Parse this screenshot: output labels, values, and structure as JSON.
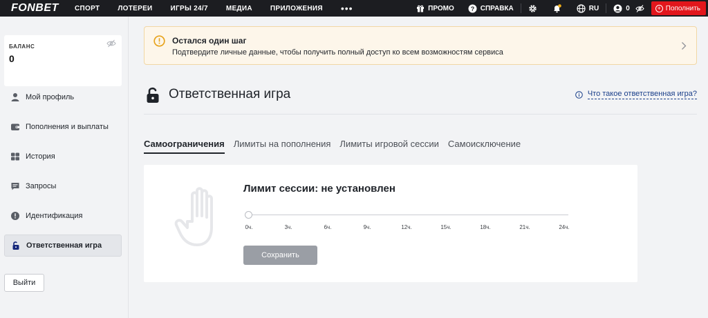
{
  "header": {
    "logo": "FONBET",
    "nav": [
      "СПОРТ",
      "ЛОТЕРЕИ",
      "ИГРЫ 24/7",
      "МЕДИА",
      "ПРИЛОЖЕНИЯ"
    ],
    "more": "•••",
    "promo_label": "ПРОМО",
    "help_label": "СПРАВКА",
    "lang": "RU",
    "account_balance": "0",
    "topup_label": "Пополнить",
    "accent_color": "#e2161c"
  },
  "sidebar": {
    "balance_label": "БАЛАНС",
    "balance_value": "0",
    "items": [
      {
        "label": "Мой профиль",
        "icon": "user-icon"
      },
      {
        "label": "Пополнения и выплаты",
        "icon": "wallet-icon"
      },
      {
        "label": "История",
        "icon": "history-icon"
      },
      {
        "label": "Запросы",
        "icon": "chat-icon"
      },
      {
        "label": "Идентификация",
        "icon": "alert-icon"
      },
      {
        "label": "Ответственная игра",
        "icon": "lock-icon",
        "active": true
      }
    ],
    "logout_label": "Выйти"
  },
  "notice": {
    "title": "Остался один шаг",
    "text": "Подтвердите личные данные, чтобы получить полный доступ ко всем возможностям сервиса"
  },
  "page": {
    "title": "Ответственная игра",
    "help_link": "Что такое ответственная игра?"
  },
  "tabs": [
    "Самоограничения",
    "Лимиты на пополнения",
    "Лимиты игровой сессии",
    "Самоисключение"
  ],
  "card": {
    "title": "Лимит сессии: не установлен",
    "ticks": [
      "0ч.",
      "3ч.",
      "6ч.",
      "9ч.",
      "12ч.",
      "15ч.",
      "18ч.",
      "21ч.",
      "24ч."
    ],
    "slider_value_hours": 0,
    "save_label": "Сохранить"
  }
}
